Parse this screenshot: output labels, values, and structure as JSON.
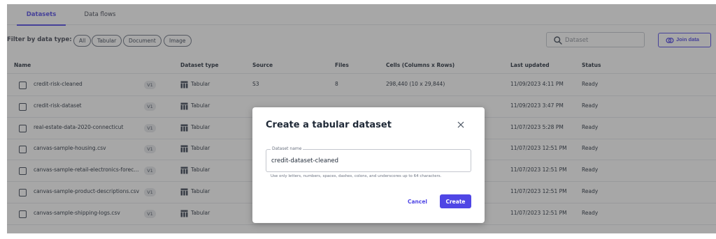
{
  "tabs": [
    {
      "label": "Datasets",
      "active": true
    },
    {
      "label": "Data flows",
      "active": false
    }
  ],
  "filter": {
    "label": "Filter by data type:",
    "chips": [
      "All",
      "Tabular",
      "Document",
      "Image"
    ]
  },
  "search": {
    "placeholder": "Dataset",
    "icon": "search-icon"
  },
  "join": {
    "label": "Join data",
    "icon": "join-icon"
  },
  "table": {
    "headers": [
      "Name",
      "Dataset type",
      "Source",
      "Files",
      "Cells (Columns x Rows)",
      "Last updated",
      "Status"
    ],
    "rows": [
      {
        "name": "credit-risk-cleaned",
        "version": "V1",
        "type": "Tabular",
        "source": "S3",
        "files": "8",
        "cells": "298,440 (10 x 29,844)",
        "updated": "11/09/2023 4:11 PM",
        "status": "Ready"
      },
      {
        "name": "credit-risk-dataset",
        "version": "V1",
        "type": "Tabular",
        "source": "",
        "files": "",
        "cells": "",
        "updated": "11/09/2023 3:47 PM",
        "status": "Ready"
      },
      {
        "name": "real-estate-data-2020-connecticut",
        "version": "V1",
        "type": "Tabular",
        "source": "",
        "files": "",
        "cells": "",
        "updated": "11/07/2023 5:28 PM",
        "status": "Ready"
      },
      {
        "name": "canvas-sample-housing.csv",
        "version": "V1",
        "type": "Tabular",
        "source": "",
        "files": "",
        "cells": "",
        "updated": "11/07/2023 12:51 PM",
        "status": "Ready"
      },
      {
        "name": "canvas-sample-retail-electronics-forec...",
        "version": "V1",
        "type": "Tabular",
        "source": "",
        "files": "",
        "cells": "",
        "updated": "11/07/2023 12:51 PM",
        "status": "Ready"
      },
      {
        "name": "canvas-sample-product-descriptions.csv",
        "version": "V1",
        "type": "Tabular",
        "source": "",
        "files": "",
        "cells": "",
        "updated": "11/07/2023 12:51 PM",
        "status": "Ready"
      },
      {
        "name": "canvas-sample-shipping-logs.csv",
        "version": "V1",
        "type": "Tabular",
        "source": "",
        "files": "",
        "cells": "",
        "updated": "11/07/2023 12:51 PM",
        "status": "Ready"
      }
    ]
  },
  "modal": {
    "title": "Create a tabular dataset",
    "field_label": "Dataset name",
    "field_value": "credit-dataset-cleaned",
    "help": "Use only letters, numbers, spaces, dashes, colons, and underscores up to 64 characters.",
    "cancel": "Cancel",
    "create": "Create",
    "close_icon": "close-icon"
  },
  "colors": {
    "accent": "#4f46e5",
    "overlay": "rgba(60,60,60,0.45)"
  }
}
